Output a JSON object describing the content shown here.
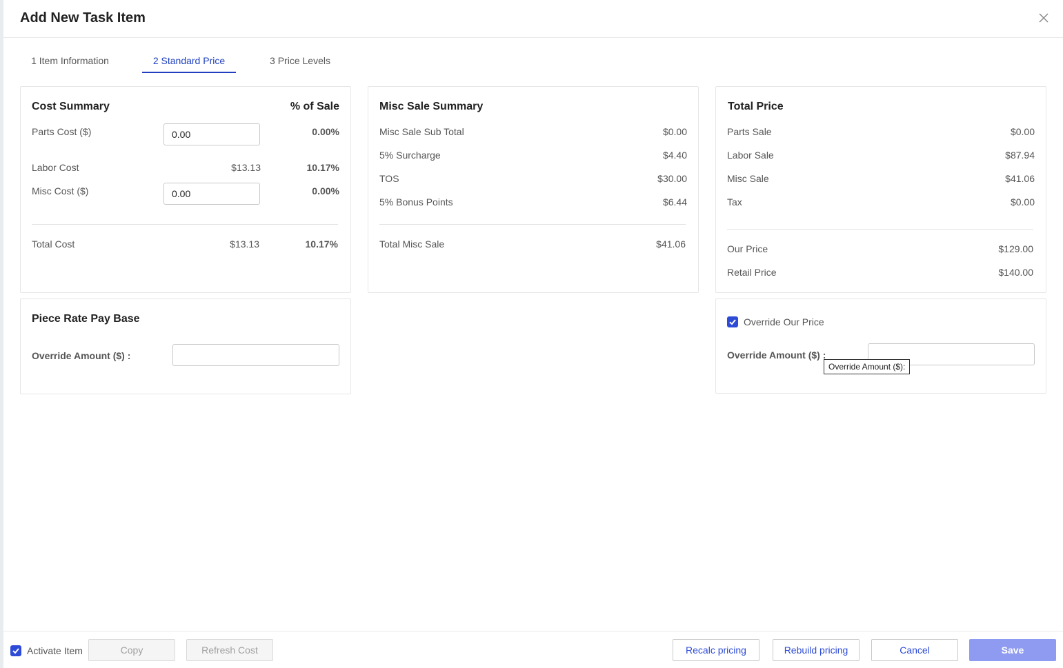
{
  "header": {
    "title": "Add New Task Item"
  },
  "tabs": [
    {
      "label": "1 Item Information",
      "active": false
    },
    {
      "label": "2 Standard Price",
      "active": true
    },
    {
      "label": "3 Price Levels",
      "active": false
    }
  ],
  "cost_summary": {
    "title": "Cost Summary",
    "pct_header": "% of Sale",
    "rows": [
      {
        "label": "Parts Cost ($)",
        "input_value": "0.00",
        "pct": "0.00%"
      },
      {
        "label": "Labor Cost",
        "value": "$13.13",
        "pct": "10.17%"
      },
      {
        "label": "Misc Cost ($)",
        "input_value": "0.00",
        "pct": "0.00%"
      }
    ],
    "total": {
      "label": "Total Cost",
      "value": "$13.13",
      "pct": "10.17%"
    }
  },
  "misc_sale_summary": {
    "title": "Misc Sale Summary",
    "rows": [
      {
        "label": "Misc Sale Sub Total",
        "value": "$0.00"
      },
      {
        "label": "5% Surcharge",
        "value": "$4.40"
      },
      {
        "label": "TOS",
        "value": "$30.00"
      },
      {
        "label": "5% Bonus Points",
        "value": "$6.44"
      }
    ],
    "total": {
      "label": "Total Misc Sale",
      "value": "$41.06"
    }
  },
  "total_price": {
    "title": "Total Price",
    "rows": [
      {
        "label": "Parts Sale",
        "value": "$0.00"
      },
      {
        "label": "Labor Sale",
        "value": "$87.94"
      },
      {
        "label": "Misc Sale",
        "value": "$41.06"
      },
      {
        "label": "Tax",
        "value": "$0.00"
      }
    ],
    "totals": [
      {
        "label": "Our Price",
        "value": "$129.00"
      },
      {
        "label": "Retail Price",
        "value": "$140.00"
      }
    ]
  },
  "piece_rate": {
    "title": "Piece Rate Pay Base",
    "override_label": "Override Amount ($) :",
    "override_value": ""
  },
  "override_our_price": {
    "checkbox_label": "Override Our Price",
    "checked": true,
    "override_label": "Override Amount ($) :",
    "override_value": "",
    "tooltip": "Override Amount ($):"
  },
  "footer": {
    "activate_label": "Activate Item",
    "activate_checked": true,
    "copy_label": "Copy",
    "refresh_cost_label": "Refresh Cost",
    "recalc_label": "Recalc pricing",
    "rebuild_label": "Rebuild pricing",
    "cancel_label": "Cancel",
    "save_label": "Save"
  },
  "colors": {
    "accent": "#2d4bd6",
    "tab_active": "#1f3fbf",
    "save_button": "#8e9bf0"
  }
}
